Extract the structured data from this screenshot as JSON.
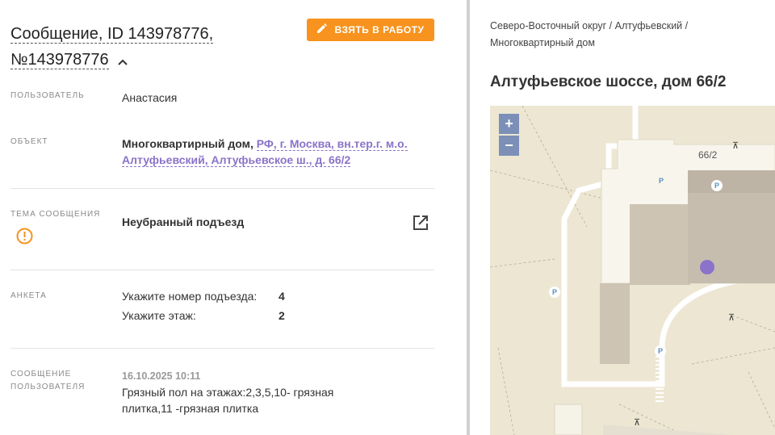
{
  "header": {
    "title": "Сообщение, ID 143978776,",
    "title_line2": "№143978776",
    "take_button": "ВЗЯТЬ В РАБОТУ"
  },
  "fields": {
    "user_label": "ПОЛЬЗОВАТЕЛЬ",
    "user_value": "Анастасия",
    "object_label": "ОБЪЕКТ",
    "object_type": "Многоквартирный дом,",
    "object_link": "РФ, г. Москва, вн.тер.г. м.о. Алтуфьевский, Алтуфьевское ш., д. 66/2",
    "topic_label": "ТЕМА СООБЩЕНИЯ",
    "topic_value": "Неубранный подъезд",
    "survey_label": "АНКЕТА",
    "survey": [
      {
        "q": "Укажите номер подъезда:",
        "a": "4"
      },
      {
        "q": "Укажите этаж:",
        "a": "2"
      }
    ],
    "message_label_1": "СООБЩЕНИЕ",
    "message_label_2": "ПОЛЬЗОВАТЕЛЯ",
    "message_date": "16.10.2025 10:11",
    "message_text": "Грязный пол на этажах:2,3,5,10- грязная плитка,11 -грязная плитка"
  },
  "location": {
    "breadcrumb_line1": "Северо-Восточный округ / Алтуфьевский /",
    "breadcrumb_line2": "Многоквартирный дом",
    "address": "Алтуфьевское шоссе, дом 66/2"
  },
  "map": {
    "house_number": "66/2",
    "zoom_in": "+",
    "zoom_out": "−",
    "parking_label": "P",
    "marker_color": "#8a73c9"
  },
  "colors": {
    "accent": "#f7931e",
    "link": "#8a73c9",
    "warning": "#f7931e"
  },
  "icons": [
    "pencil-icon",
    "chevron-up-icon",
    "warning-circle-icon",
    "external-link-icon"
  ]
}
